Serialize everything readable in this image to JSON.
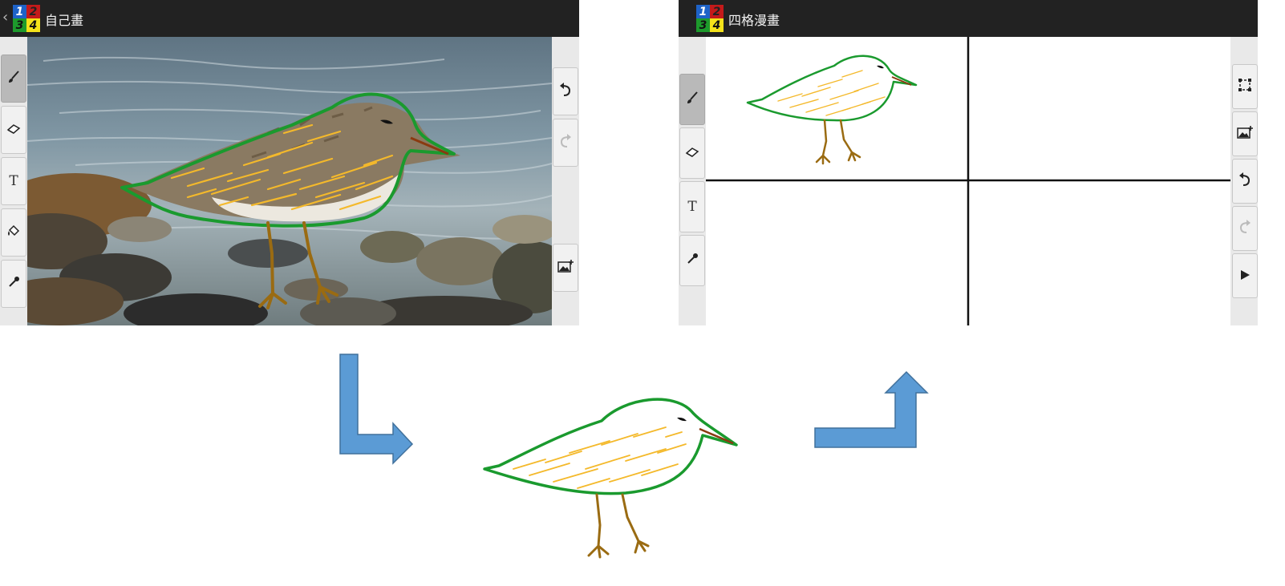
{
  "left_screen": {
    "back_glyph": "‹",
    "logo": [
      "1",
      "2",
      "3",
      "4"
    ],
    "title": "自己畫",
    "left_tools": [
      "brush-icon",
      "eraser-icon",
      "text-tool-icon",
      "paint-bucket-icon",
      "eyedropper-icon"
    ],
    "text_tool_label": "T",
    "right_tools": [
      "undo-icon",
      "redo-icon",
      "add-image-icon"
    ]
  },
  "right_screen": {
    "logo": [
      "1",
      "2",
      "3",
      "4"
    ],
    "title": "四格漫畫",
    "text_tool_label": "T",
    "left_tools": [
      "brush-icon",
      "eraser-icon",
      "text-tool-icon",
      "eyedropper-icon"
    ],
    "right_tools": [
      "select-frame-icon",
      "add-image-icon",
      "undo-icon",
      "redo-icon",
      "play-icon"
    ]
  },
  "colors": {
    "titlebar": "#222222",
    "outline": "#1a9a2e",
    "hatch": "#f4b92b",
    "legs": "#9a6b12",
    "arrow_fill": "#5b9bd5",
    "arrow_stroke": "#41719c"
  }
}
